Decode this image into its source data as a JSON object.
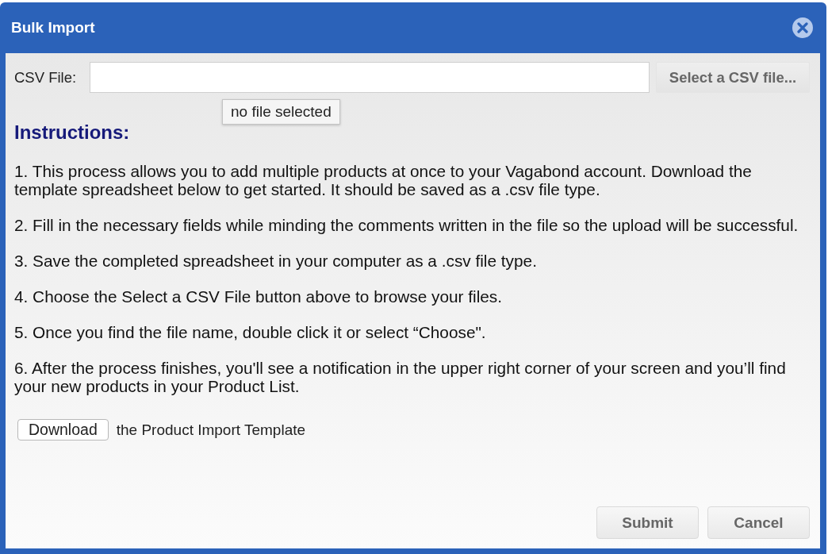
{
  "dialog": {
    "title": "Bulk Import"
  },
  "csv_file": {
    "label": "CSV File:",
    "button": "Select a CSV file...",
    "tooltip": "no file selected"
  },
  "instructions": {
    "heading": "Instructions:",
    "steps": [
      "1. This process allows you to add multiple products at once to your Vagabond account. Download the template spreadsheet below to get started. It should be saved as a .csv file type.",
      "2. Fill in the necessary fields while minding the comments written in the file so the upload will be successful.",
      "3. Save the completed spreadsheet in your computer as a .csv file type.",
      "4. Choose the Select a CSV File button above to browse your files.",
      "5. Once you find the file name, double click it or select “Choose\".",
      "6. After the process finishes, you'll see a notification in the upper right corner of your screen and you’ll find your new products in your Product List."
    ]
  },
  "download": {
    "button": "Download",
    "text": "the Product Import Template"
  },
  "buttons": [
    {
      "label": "Submit"
    },
    {
      "label": "Cancel"
    }
  ]
}
